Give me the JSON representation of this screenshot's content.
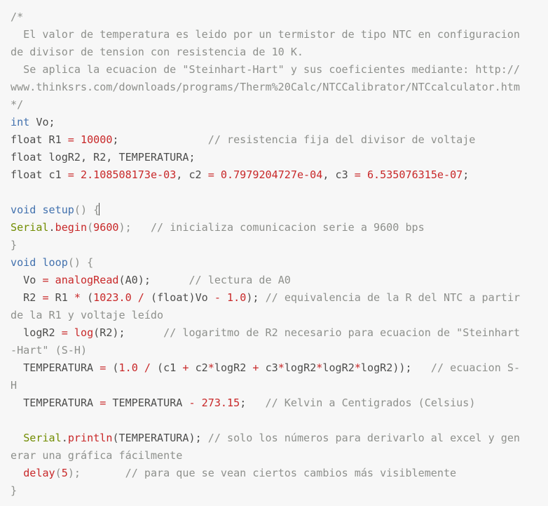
{
  "code": {
    "lines": [
      [
        {
          "t": "/*",
          "c": "cmt"
        }
      ],
      [
        {
          "t": "  El valor de temperatura es leido por un termistor de tipo NTC en configuracion",
          "c": "cmt"
        }
      ],
      [
        {
          "t": "de divisor de tension con resistencia de 10 K.",
          "c": "cmt"
        }
      ],
      [
        {
          "t": "  Se aplica la ecuacion de \"Steinhart-Hart\" y sus coeficientes mediante: http://",
          "c": "cmt"
        }
      ],
      [
        {
          "t": "www.thinksrs.com/downloads/programs/Therm%20Calc/NTCCalibrator/NTCcalculator.htm",
          "c": "cmt"
        }
      ],
      [
        {
          "t": "*/",
          "c": "cmt"
        }
      ],
      [
        {
          "t": "int",
          "c": "kw"
        },
        {
          "t": " Vo;",
          "c": "plain"
        }
      ],
      [
        {
          "t": "float R1 ",
          "c": "plain"
        },
        {
          "t": "=",
          "c": "op"
        },
        {
          "t": " ",
          "c": "plain"
        },
        {
          "t": "10000",
          "c": "num"
        },
        {
          "t": ";              ",
          "c": "plain"
        },
        {
          "t": "// resistencia fija del divisor de voltaje",
          "c": "cmt"
        }
      ],
      [
        {
          "t": "float logR2, R2, TEMPERATURA;",
          "c": "plain"
        }
      ],
      [
        {
          "t": "float c1 ",
          "c": "plain"
        },
        {
          "t": "=",
          "c": "op"
        },
        {
          "t": " ",
          "c": "plain"
        },
        {
          "t": "2.108508173e-03",
          "c": "num"
        },
        {
          "t": ", c2 ",
          "c": "plain"
        },
        {
          "t": "=",
          "c": "op"
        },
        {
          "t": " ",
          "c": "plain"
        },
        {
          "t": "0.7979204727e-04",
          "c": "num"
        },
        {
          "t": ", c3 ",
          "c": "plain"
        },
        {
          "t": "=",
          "c": "op"
        },
        {
          "t": " ",
          "c": "plain"
        },
        {
          "t": "6.535076315e-07",
          "c": "num"
        },
        {
          "t": ";",
          "c": "plain"
        }
      ],
      [],
      [
        {
          "t": "void",
          "c": "kw"
        },
        {
          "t": " ",
          "c": "plain"
        },
        {
          "t": "setup",
          "c": "kw"
        },
        {
          "t": "() {",
          "c": "punc"
        },
        {
          "t": "",
          "c": "cursor"
        }
      ],
      [
        {
          "t": "Serial",
          "c": "fn"
        },
        {
          "t": ".",
          "c": "plain"
        },
        {
          "t": "begin",
          "c": "fnc"
        },
        {
          "t": "(",
          "c": "punc"
        },
        {
          "t": "9600",
          "c": "num"
        },
        {
          "t": ");   ",
          "c": "punc"
        },
        {
          "t": "// inicializa comunicacion serie a 9600 bps",
          "c": "cmt"
        }
      ],
      [
        {
          "t": "}",
          "c": "punc"
        }
      ],
      [
        {
          "t": "void",
          "c": "kw"
        },
        {
          "t": " ",
          "c": "plain"
        },
        {
          "t": "loop",
          "c": "kw"
        },
        {
          "t": "() {",
          "c": "punc"
        }
      ],
      [
        {
          "t": "  Vo ",
          "c": "plain"
        },
        {
          "t": "=",
          "c": "op"
        },
        {
          "t": " ",
          "c": "plain"
        },
        {
          "t": "analogRead",
          "c": "fnc"
        },
        {
          "t": "(A0);      ",
          "c": "plain"
        },
        {
          "t": "// lectura de A0",
          "c": "cmt"
        }
      ],
      [
        {
          "t": "  R2 ",
          "c": "plain"
        },
        {
          "t": "=",
          "c": "op"
        },
        {
          "t": " R1 ",
          "c": "plain"
        },
        {
          "t": "*",
          "c": "op"
        },
        {
          "t": " (",
          "c": "plain"
        },
        {
          "t": "1023.0",
          "c": "num"
        },
        {
          "t": " ",
          "c": "plain"
        },
        {
          "t": "/",
          "c": "op"
        },
        {
          "t": " (float)Vo ",
          "c": "plain"
        },
        {
          "t": "-",
          "c": "op"
        },
        {
          "t": " ",
          "c": "plain"
        },
        {
          "t": "1.0",
          "c": "num"
        },
        {
          "t": "); ",
          "c": "plain"
        },
        {
          "t": "// equivalencia de la R del NTC a partir",
          "c": "cmt"
        }
      ],
      [
        {
          "t": "de la R1 y voltaje leído",
          "c": "cmt"
        }
      ],
      [
        {
          "t": "  logR2 ",
          "c": "plain"
        },
        {
          "t": "=",
          "c": "op"
        },
        {
          "t": " ",
          "c": "plain"
        },
        {
          "t": "log",
          "c": "fnc"
        },
        {
          "t": "(R2);      ",
          "c": "plain"
        },
        {
          "t": "// logaritmo de R2 necesario para ecuacion de \"Steinhart",
          "c": "cmt"
        }
      ],
      [
        {
          "t": "-Hart\" (S-H)",
          "c": "cmt"
        }
      ],
      [
        {
          "t": "  TEMPERATURA ",
          "c": "plain"
        },
        {
          "t": "=",
          "c": "op"
        },
        {
          "t": " (",
          "c": "plain"
        },
        {
          "t": "1.0",
          "c": "num"
        },
        {
          "t": " ",
          "c": "plain"
        },
        {
          "t": "/",
          "c": "op"
        },
        {
          "t": " (c1 ",
          "c": "plain"
        },
        {
          "t": "+",
          "c": "op"
        },
        {
          "t": " c2",
          "c": "plain"
        },
        {
          "t": "*",
          "c": "op"
        },
        {
          "t": "logR2 ",
          "c": "plain"
        },
        {
          "t": "+",
          "c": "op"
        },
        {
          "t": " c3",
          "c": "plain"
        },
        {
          "t": "*",
          "c": "op"
        },
        {
          "t": "logR2",
          "c": "plain"
        },
        {
          "t": "*",
          "c": "op"
        },
        {
          "t": "logR2",
          "c": "plain"
        },
        {
          "t": "*",
          "c": "op"
        },
        {
          "t": "logR2));   ",
          "c": "plain"
        },
        {
          "t": "// ecuacion S-",
          "c": "cmt"
        }
      ],
      [
        {
          "t": "H",
          "c": "cmt"
        }
      ],
      [
        {
          "t": "  TEMPERATURA ",
          "c": "plain"
        },
        {
          "t": "=",
          "c": "op"
        },
        {
          "t": " TEMPERATURA ",
          "c": "plain"
        },
        {
          "t": "-",
          "c": "op"
        },
        {
          "t": " ",
          "c": "plain"
        },
        {
          "t": "273.15",
          "c": "num"
        },
        {
          "t": ";   ",
          "c": "plain"
        },
        {
          "t": "// Kelvin a Centigrados (Celsius)",
          "c": "cmt"
        }
      ],
      [],
      [
        {
          "t": "  ",
          "c": "plain"
        },
        {
          "t": "Serial",
          "c": "fn"
        },
        {
          "t": ".",
          "c": "plain"
        },
        {
          "t": "println",
          "c": "fnc"
        },
        {
          "t": "(TEMPERATURA); ",
          "c": "plain"
        },
        {
          "t": "// solo los números para derivarlo al excel y gen",
          "c": "cmt"
        }
      ],
      [
        {
          "t": "erar una gráfica fácilmente",
          "c": "cmt"
        }
      ],
      [
        {
          "t": "  ",
          "c": "plain"
        },
        {
          "t": "delay",
          "c": "fnc"
        },
        {
          "t": "(",
          "c": "punc"
        },
        {
          "t": "5",
          "c": "num"
        },
        {
          "t": ");       ",
          "c": "punc"
        },
        {
          "t": "// para que se vean ciertos cambios más visiblemente",
          "c": "cmt"
        }
      ],
      [
        {
          "t": "}",
          "c": "punc"
        }
      ]
    ]
  }
}
